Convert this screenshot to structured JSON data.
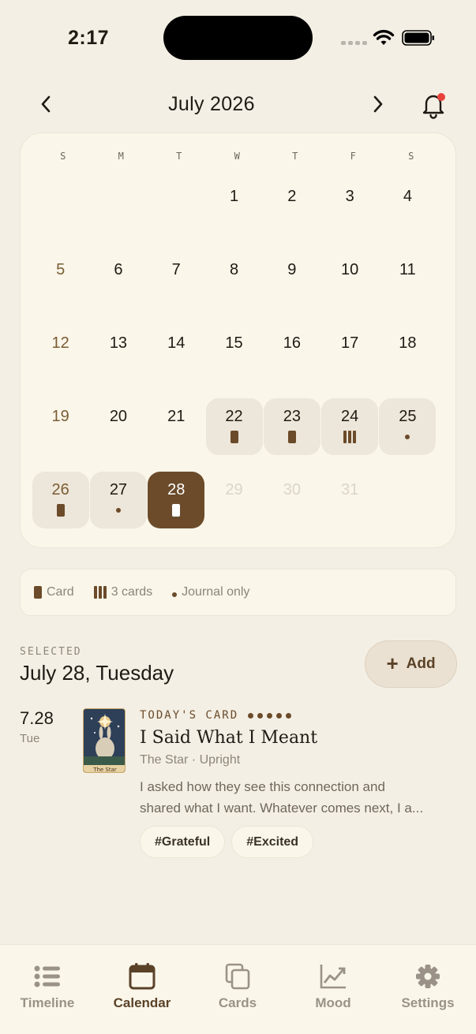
{
  "status": {
    "time": "2:17"
  },
  "header": {
    "month": "July 2026"
  },
  "calendar": {
    "weekdays": [
      "S",
      "M",
      "T",
      "W",
      "T",
      "F",
      "S"
    ],
    "days": [
      {
        "label": ""
      },
      {
        "label": ""
      },
      {
        "label": ""
      },
      {
        "label": "1"
      },
      {
        "label": "2"
      },
      {
        "label": "3"
      },
      {
        "label": "4"
      },
      {
        "label": "5",
        "sun": true
      },
      {
        "label": "6"
      },
      {
        "label": "7"
      },
      {
        "label": "8"
      },
      {
        "label": "9"
      },
      {
        "label": "10"
      },
      {
        "label": "11"
      },
      {
        "label": "12",
        "sun": true
      },
      {
        "label": "13"
      },
      {
        "label": "14"
      },
      {
        "label": "15"
      },
      {
        "label": "16"
      },
      {
        "label": "17"
      },
      {
        "label": "18"
      },
      {
        "label": "19",
        "sun": true
      },
      {
        "label": "20"
      },
      {
        "label": "21"
      },
      {
        "label": "22",
        "mark": "card"
      },
      {
        "label": "23",
        "mark": "card"
      },
      {
        "label": "24",
        "mark": "3cards"
      },
      {
        "label": "25",
        "mark": "journal"
      },
      {
        "label": "26",
        "sun": true,
        "mark": "card"
      },
      {
        "label": "27",
        "mark": "journal"
      },
      {
        "label": "28",
        "mark": "card",
        "selected": true
      },
      {
        "label": "29",
        "faded": true
      },
      {
        "label": "30",
        "faded": true
      },
      {
        "label": "31",
        "faded": true
      }
    ]
  },
  "legend": {
    "card": "Card",
    "three_cards": "3 cards",
    "journal": "Journal only"
  },
  "selected": {
    "label": "SELECTED",
    "date": "July 28, Tuesday",
    "add_label": "Add"
  },
  "entry": {
    "num": "7.28",
    "day": "Tue",
    "kicker": "TODAY'S CARD",
    "title": "I Said What I Meant",
    "subtitle": "The Star · Upright",
    "card_name": "The Star",
    "body_line1": "I asked how they see this connection and",
    "body_line2": "shared what I want. Whatever comes next, I a...",
    "tags": [
      "#Grateful",
      "#Excited"
    ]
  },
  "tabs": [
    {
      "label": "Timeline",
      "icon": "list-icon"
    },
    {
      "label": "Calendar",
      "icon": "calendar-icon",
      "active": true
    },
    {
      "label": "Cards",
      "icon": "cards-icon"
    },
    {
      "label": "Mood",
      "icon": "chart-icon"
    },
    {
      "label": "Settings",
      "icon": "gear-icon"
    }
  ],
  "colors": {
    "accent": "#6b4b2a",
    "background": "#f4efe4",
    "notification": "#e8423a"
  }
}
